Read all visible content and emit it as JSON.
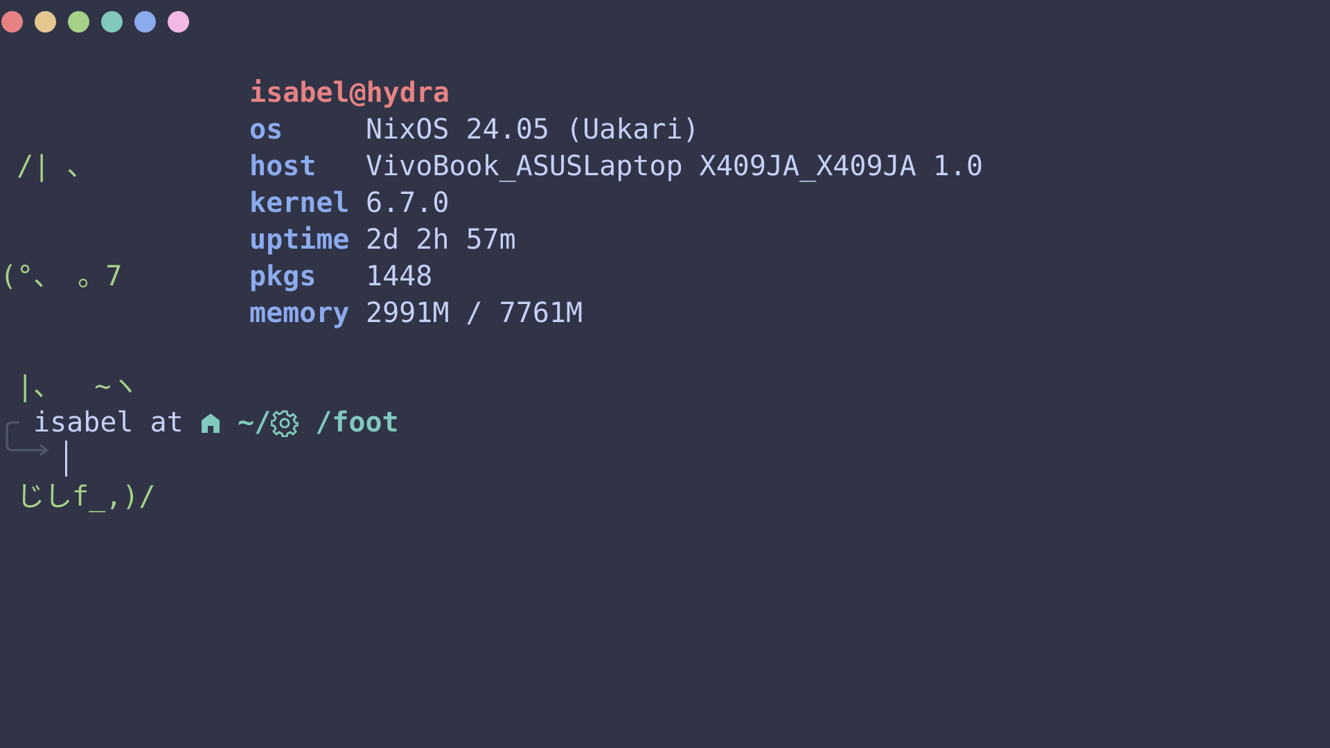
{
  "window": {
    "dots": [
      {
        "name": "red",
        "color": "#e78284"
      },
      {
        "name": "yellow",
        "color": "#e5c890"
      },
      {
        "name": "green",
        "color": "#a6d189"
      },
      {
        "name": "teal",
        "color": "#81c8be"
      },
      {
        "name": "blue",
        "color": "#8caaee"
      },
      {
        "name": "pink",
        "color": "#f4b8e4"
      }
    ]
  },
  "ascii_art": [
    " /| 、",
    "(°、 。7",
    " |、  ~ヽ",
    " じしf_,)/"
  ],
  "fetch": {
    "title": "isabel@hydra",
    "rows": [
      {
        "key": "os",
        "value": "NixOS 24.05 (Uakari)"
      },
      {
        "key": "host",
        "value": "VivoBook_ASUSLaptop X409JA_X409JA 1.0"
      },
      {
        "key": "kernel",
        "value": "6.7.0"
      },
      {
        "key": "uptime",
        "value": "2d 2h 57m"
      },
      {
        "key": "pkgs",
        "value": "1448"
      },
      {
        "key": "memory",
        "value": "2991M / 7761M"
      }
    ]
  },
  "prompt": {
    "user": "isabel",
    "at": "at",
    "path_prefix": "~/",
    "path_suffix": "/foot",
    "home_icon": "home-icon",
    "gear_icon": "gear-icon"
  },
  "colors": {
    "background": "#303446",
    "text": "#c6d0f5",
    "title": "#e78284",
    "key": "#8caaee",
    "ascii": "#a6d189",
    "path": "#81c8be",
    "bracket": "#51576d"
  }
}
